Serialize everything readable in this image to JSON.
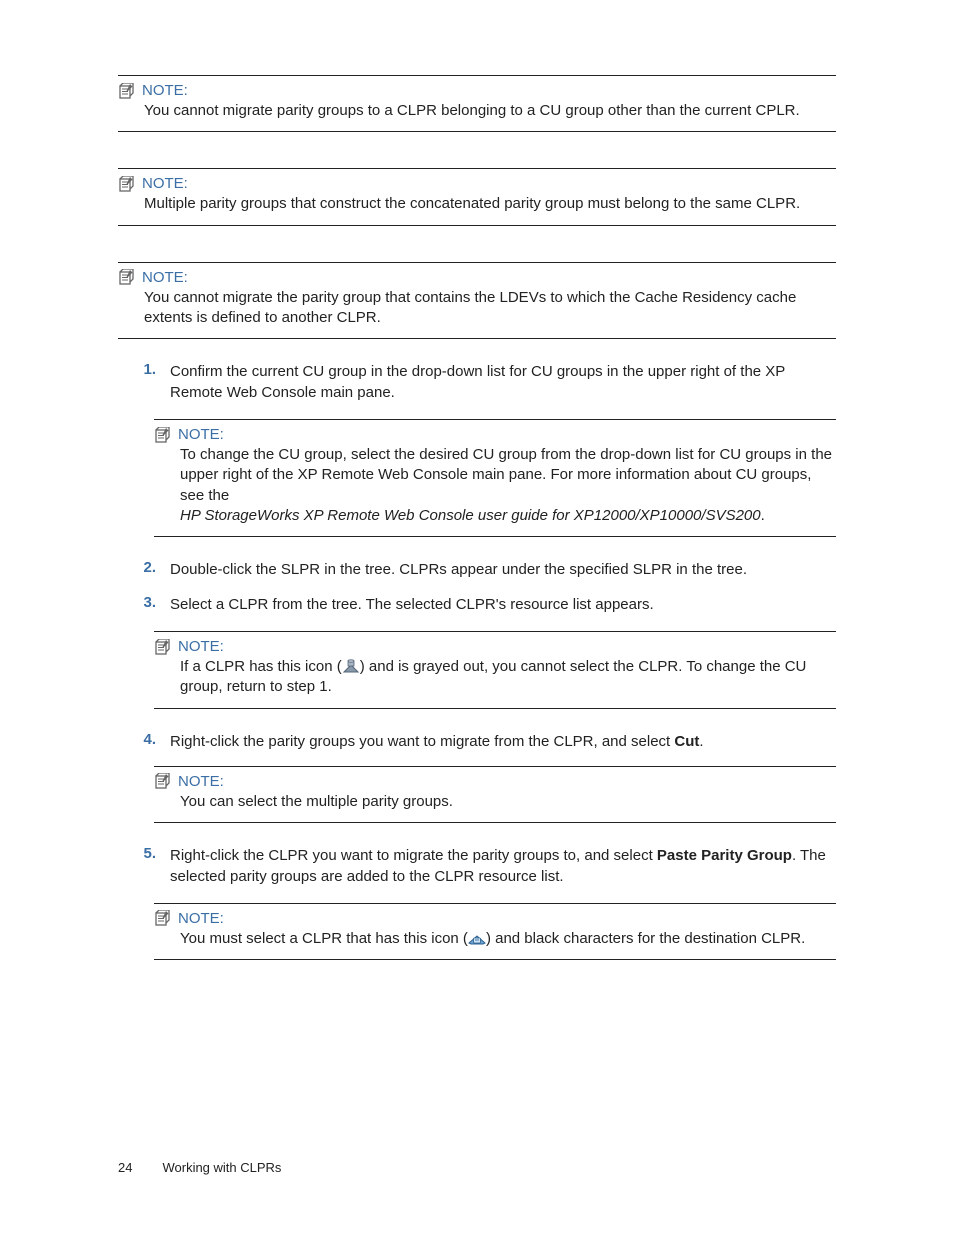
{
  "noteLabel": "NOTE:",
  "notes": {
    "a": "You cannot migrate parity groups to a CLPR belonging to a CU group other than the current CPLR.",
    "b": "Multiple parity groups that construct the concatenated parity group must belong to the same CLPR.",
    "c": "You cannot migrate the parity group that contains the LDEVs to which the Cache Residency cache extents is defined to another CLPR.",
    "d_line1": "To change the CU group, select the desired CU group from the drop-down list for CU groups in the upper right of the XP Remote Web Console main pane. For more information about CU groups, see the",
    "d_italic": "HP StorageWorks XP Remote Web Console user guide for XP12000/XP10000/SVS200",
    "e_pre": "If a CLPR has this icon (",
    "e_post": ") and is grayed out, you cannot select the CLPR. To change the CU group, return to step 1.",
    "f": "You can select the multiple parity groups.",
    "g_pre": "You must select a CLPR that has this icon (",
    "g_post": ") and black characters for the destination CLPR."
  },
  "steps": {
    "s1": "Confirm the current CU group in the drop-down list for CU groups in the upper right of the XP Remote Web Console main pane.",
    "s2": "Double-click the SLPR in the tree. CLPRs appear under the specified SLPR in the tree.",
    "s3": "Select a CLPR from the tree. The selected CLPR's resource list appears.",
    "s4_pre": "Right-click the parity groups you want to migrate from the CLPR, and select ",
    "s4_bold": "Cut",
    "s4_post": ".",
    "s5_pre": "Right-click the CLPR you want to migrate the parity groups to, and select ",
    "s5_bold": "Paste Parity Group",
    "s5_post": ". The selected parity groups are added to the CLPR resource list."
  },
  "stepNums": {
    "n1": "1.",
    "n2": "2.",
    "n3": "3.",
    "n4": "4.",
    "n5": "5."
  },
  "footer": {
    "page": "24",
    "section": "Working with CLPRs"
  }
}
